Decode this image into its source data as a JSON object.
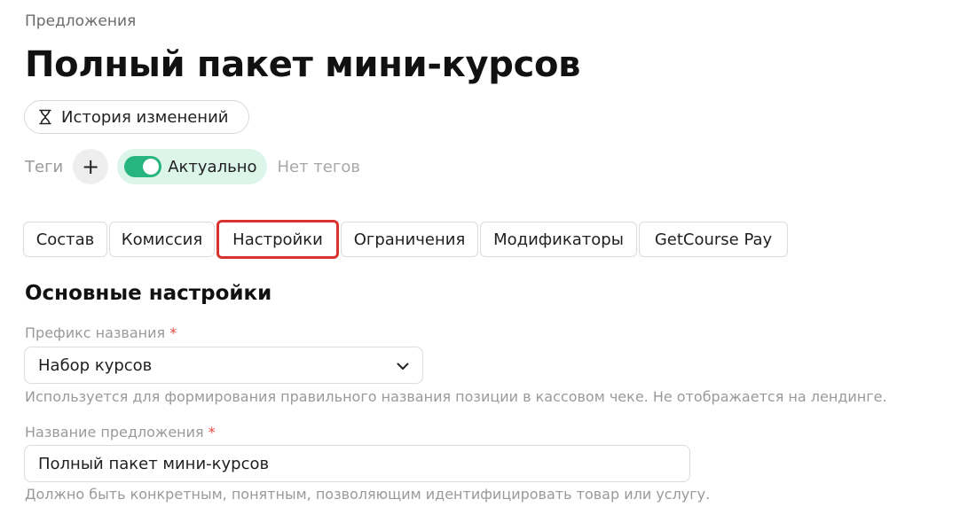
{
  "breadcrumb": "Предложения",
  "page_title": "Полный пакет мини-курсов",
  "history_button": {
    "icon": "hourglass-icon",
    "label": "История изменений"
  },
  "tags": {
    "label": "Теги",
    "add_icon": "plus-icon",
    "add_symbol": "+",
    "status_toggle_on": true,
    "status_label": "Актуально",
    "empty_text": "Нет тегов",
    "toggle_color": "#27b47e",
    "pill_color": "#dcf5ea"
  },
  "tabs": [
    {
      "label": "Состав",
      "active": false
    },
    {
      "label": "Комиссия",
      "active": false
    },
    {
      "label": "Настройки",
      "active": true
    },
    {
      "label": "Ограничения",
      "active": false
    },
    {
      "label": "Модификаторы",
      "active": false
    },
    {
      "label": "GetCourse Pay",
      "active": false
    }
  ],
  "active_tab_highlight_color": "#d9332e",
  "section": {
    "title": "Основные настройки"
  },
  "fields": {
    "prefix": {
      "label": "Префикс названия",
      "required_mark": "*",
      "value": "Набор курсов",
      "dropdown_icon": "chevron-down-icon",
      "hint": "Используется для формирования правильного названия позиции в кассовом чеке. Не отображается на лендинге."
    },
    "offer_name": {
      "label": "Название предложения",
      "required_mark": "*",
      "value": "Полный пакет мини-курсов",
      "hint": "Должно быть конкретным, понятным, позволяющим идентифицировать товар или услугу."
    }
  }
}
